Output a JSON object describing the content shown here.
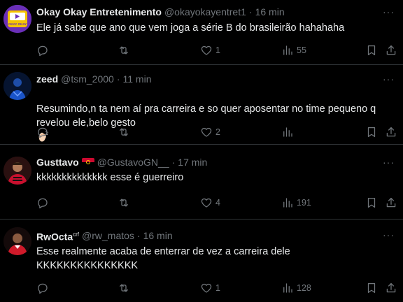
{
  "tweets": [
    {
      "name": "Okay Okay Entretenimento",
      "handle": "@okayokayentret1",
      "time": "16 min",
      "text": "Ele já sabe que ano que vem joga a série B do brasileirão hahahaha",
      "likes": "1",
      "views": "55",
      "avatar_logo_text": "OKAY OKAY"
    },
    {
      "name": "zeed",
      "handle": "@tsm_2000",
      "time": "11 min",
      "text": "Resumindo,n ta nem aí pra carreira e so quer aposentar no time pequeno q revelou ele,belo gesto",
      "likes": "2",
      "views": ""
    },
    {
      "name": "Gusttavo",
      "handle": "@GustavoGN__",
      "time": "17 min",
      "text": "kkkkkkkkkkkkkk esse é guerreiro",
      "likes": "4",
      "views": "191"
    },
    {
      "name": "RwOcta",
      "name_suffix": "crf",
      "handle": "@rw_matos",
      "time": "16 min",
      "text": "Esse realmente acaba de enterrar de vez a carreira dele\nKKKKKKKKKKKKKKK",
      "likes": "1",
      "views": "128"
    }
  ],
  "separator": "·",
  "more_glyph": "···",
  "colors": {
    "background": "#000000",
    "text": "#e7e9ea",
    "muted": "#71767b",
    "border": "#2f3336"
  },
  "icons": [
    "reply-icon",
    "retweet-icon",
    "like-icon",
    "views-icon",
    "bookmark-icon",
    "share-icon",
    "angola-flag-icon",
    "clap-emoji-icon"
  ]
}
